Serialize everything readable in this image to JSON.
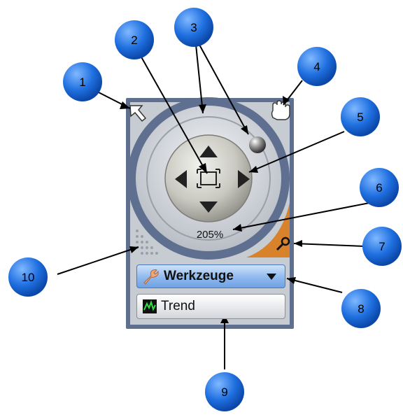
{
  "zoom": {
    "value_label": "205%"
  },
  "toolbar": {
    "tools_label": "Werkzeuge"
  },
  "trend": {
    "label": "Trend"
  },
  "callouts": [
    {
      "label": "1"
    },
    {
      "label": "2"
    },
    {
      "label": "3"
    },
    {
      "label": "4"
    },
    {
      "label": "5"
    },
    {
      "label": "6"
    },
    {
      "label": "7"
    },
    {
      "label": "8"
    },
    {
      "label": "9"
    },
    {
      "label": "10"
    }
  ],
  "colors": {
    "panel_frame": "#5f6f90",
    "callout_fill": "#1f6fe0",
    "zoom_accent": "#d8822b",
    "combo_blue": "#8fb9ee"
  }
}
